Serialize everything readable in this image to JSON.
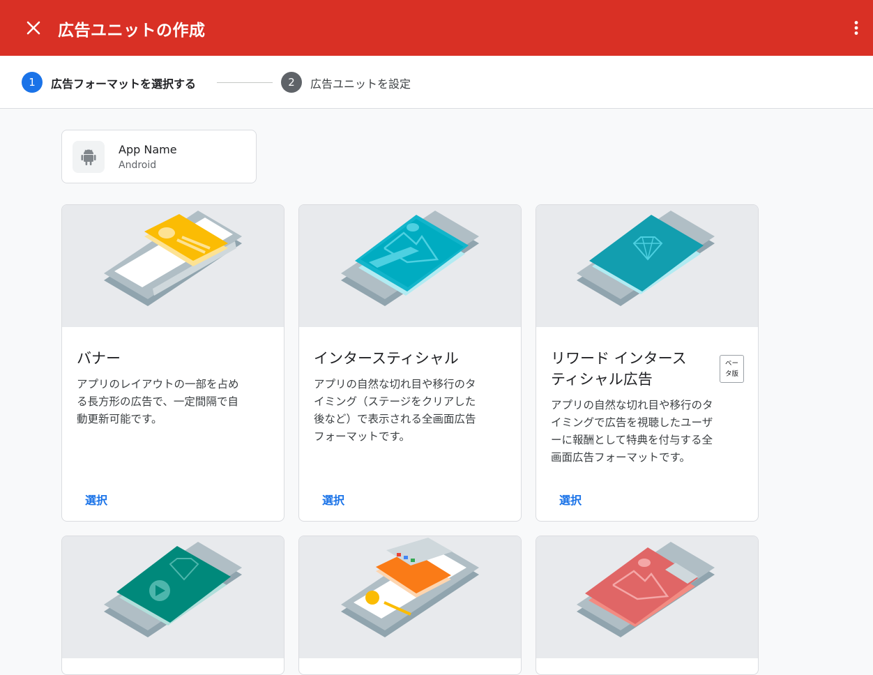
{
  "header": {
    "title": "広告ユニットの作成",
    "close_icon": "close-icon",
    "more_icon": "more-vert-icon",
    "color": "#d93025"
  },
  "stepper": {
    "steps": [
      {
        "number": "1",
        "label": "広告フォーマットを選択する",
        "active": true,
        "color": "#1a73e8"
      },
      {
        "number": "2",
        "label": "広告ユニットを設定",
        "active": false,
        "color": "#5f6368"
      }
    ]
  },
  "app": {
    "name": "App Name",
    "platform": "Android",
    "icon": "android-icon"
  },
  "formats": [
    {
      "title": "バナー",
      "desc": [
        "アプリのレイアウトの一部を占め",
        "る長方形の広告で、一定間隔で自",
        "動更新可能です。"
      ],
      "action": "選択",
      "illus": "banner-illustration"
    },
    {
      "title": "インタースティシャル",
      "desc": [
        "アプリの自然な切れ目や移行のタ",
        "イミング（ステージをクリアした",
        "後など）で表示される全画面広告",
        "フォーマットです。"
      ],
      "action": "選択",
      "illus": "interstitial-illustration"
    },
    {
      "title_lines": [
        "リワード インタース",
        "ティシャル広告"
      ],
      "badge_lines": [
        "ベー",
        "タ版"
      ],
      "desc": [
        "アプリの自然な切れ目や移行のタ",
        "イミングで広告を視聴したユーザ",
        "ーに報酬として特典を付与する全",
        "画面広告フォーマットです。"
      ],
      "action": "選択",
      "illus": "rewarded-interstitial-illustration"
    },
    {
      "illus": "rewarded-illustration"
    },
    {
      "illus": "native-illustration"
    },
    {
      "illus": "app-open-illustration"
    }
  ],
  "colors": {
    "accent": "#1a73e8",
    "banner": "#fbbc04",
    "interstitial": "#12b5cb",
    "rewarded_interstitial": "#129eaf",
    "rewarded": "#00897b",
    "native": "#fa7b17",
    "app_open": "#e06666"
  }
}
